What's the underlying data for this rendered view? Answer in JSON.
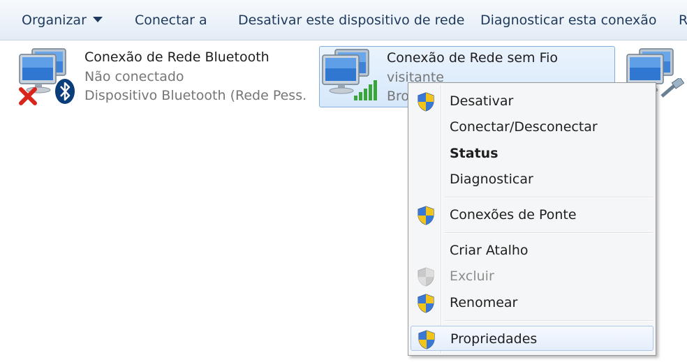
{
  "toolbar": {
    "organize_label": "Organizar",
    "connect_label": "Conectar a",
    "disable_label": "Desativar este dispositivo de rede",
    "diagnose_label": "Diagnosticar esta conexão",
    "more_label": "R"
  },
  "connections": [
    {
      "name": "Conexão de Rede Bluetooth",
      "status": "Não conectado",
      "device": "Dispositivo Bluetooth (Rede Pess...",
      "icon": "network-computer-icon",
      "overlay_icons": [
        "red-x-icon",
        "bluetooth-icon"
      ]
    },
    {
      "name": "Conexão de Rede sem Fio",
      "status": "visitante",
      "device": "Bro",
      "icon": "network-computer-icon",
      "overlay_icons": [
        "signal-bars-icon"
      ],
      "selected": true
    },
    {
      "icon": "network-computer-icon",
      "overlay_icons": [
        "ethernet-cable-icon"
      ]
    }
  ],
  "context_menu": {
    "items": [
      {
        "label": "Desativar",
        "shield": true
      },
      {
        "label": "Conectar/Desconectar",
        "shield": false
      },
      {
        "label": "Status",
        "shield": false,
        "bold": true
      },
      {
        "label": "Diagnosticar",
        "shield": false
      },
      {
        "label": "Conexões de Ponte",
        "shield": true
      },
      {
        "label": "Criar Atalho",
        "shield": false
      },
      {
        "label": "Excluir",
        "shield": true,
        "disabled": true
      },
      {
        "label": "Renomear",
        "shield": true
      },
      {
        "label": "Propriedades",
        "shield": true,
        "highlighted": true
      }
    ]
  },
  "colors": {
    "toolbar_text": "#1e395b",
    "selection_border": "#84acdd",
    "secondary_text": "#767676",
    "disabled_text": "#8d8d8d",
    "signal_green": "#3aa53a",
    "error_red": "#d9261c",
    "bluetooth_blue": "#0a3d7a"
  }
}
